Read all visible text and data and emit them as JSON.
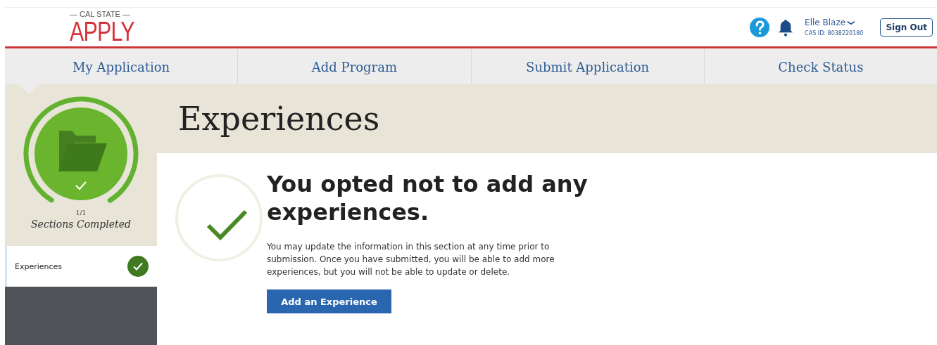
{
  "logo": {
    "tagline": "— CAL STATE —",
    "name": "APPLY"
  },
  "user": {
    "name": "Elle Blaze",
    "caret": "❯",
    "cas_id": "CAS ID: 8038220180"
  },
  "sign_out": "Sign Out",
  "tabs": [
    {
      "label": "My Application",
      "selected": true
    },
    {
      "label": "Add Program",
      "selected": false
    },
    {
      "label": "Submit Application",
      "selected": false
    },
    {
      "label": "Check Status",
      "selected": false
    }
  ],
  "progress": {
    "count": "1/1",
    "label": "Sections Completed"
  },
  "sections": [
    {
      "label": "Experiences",
      "checked": true
    }
  ],
  "page_title": "Experiences",
  "message": {
    "heading": "You opted not to add any experiences.",
    "body": "You may update the information in this section at any time prior to submission. Once you have submitted, you will be able to add more experiences, but you will not be able to update or delete.",
    "button": "Add an Experience"
  }
}
